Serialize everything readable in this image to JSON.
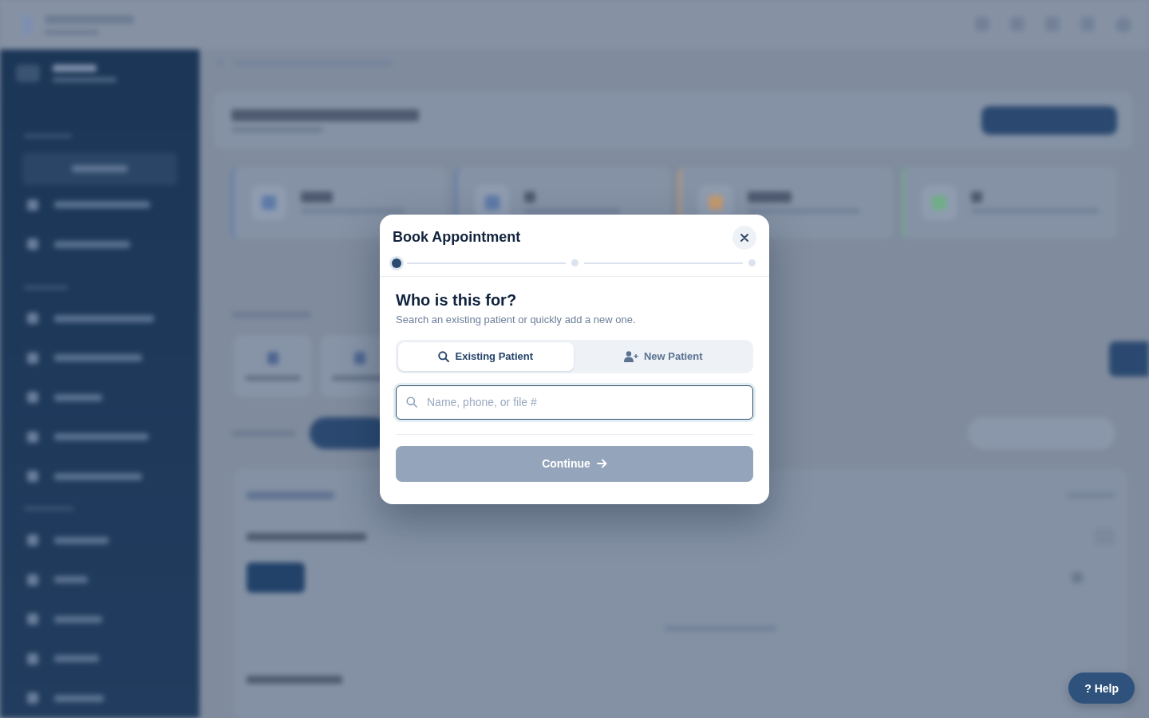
{
  "modal": {
    "title": "Book Appointment",
    "steps": [
      {
        "selected": true
      },
      {
        "selected": false
      },
      {
        "selected": false
      }
    ],
    "heading": "Who is this for?",
    "subtitle": "Search an existing patient or quickly add a new one.",
    "tabs": [
      {
        "kind": "existing",
        "label": "Existing Patient",
        "selected": true
      },
      {
        "kind": "new",
        "label": "New Patient",
        "selected": false
      }
    ],
    "search": {
      "placeholder": "Name, phone, or file #"
    },
    "continue_button": {
      "label": "Continue",
      "disabled": true
    }
  },
  "help_button": {
    "label": "? Help"
  }
}
